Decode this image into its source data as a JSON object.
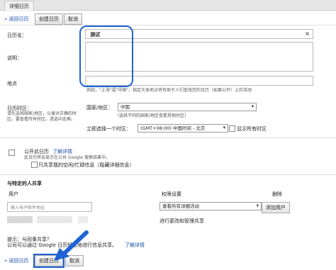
{
  "tab": "详细日历",
  "top_actions": {
    "back": "« 返回日历",
    "create": "创建日历",
    "cancel": "取消"
  },
  "form": {
    "name_label": "日历名：",
    "name_value": "测试",
    "desc_label": "说明：",
    "location_label": "地点",
    "location_hint": "例如，\"上海\"或\"中国\"，指定大体地点将有助于人们查找您的日历（如果公开）上的活动",
    "tz_label": "日历时区：",
    "tz_help": "请先选择国家/地区，以便对正确的时区。要查看所有时区，请选中此框。",
    "country_label": "国家/地区：",
    "country_value": "中国",
    "country_hint": "（选择不同的国家/地区查看其他时区）",
    "tz_now_label": "立即选择一个时区：",
    "tz_value": "(GMT+08:00) 中国时间 - 北京",
    "show_all_tz": "显示所有时区"
  },
  "public": {
    "label": "公开此日历",
    "learn_more": "了解详情",
    "note": "此日历将会显示在公共 Google 搜索结果中。",
    "free_busy": "只共享我的空闲/忙碌信息（隐藏详细信息）"
  },
  "share": {
    "title": "与特定的人共享",
    "col_user": "用户",
    "col_perm": "权限设置",
    "col_delete": "删除",
    "email_placeholder": "输入电子邮件地址",
    "perm_value": "查看所有详细活动",
    "add_button": "添加用户",
    "manage": "进行更改和管理共享"
  },
  "tip": {
    "line1": "提示：与同事共享？",
    "line2": "公司可以通过 Google 日历轻松地进行信息共享。",
    "learn_more": "了解详情"
  },
  "bottom_actions": {
    "back": "« 返回日历",
    "create": "创建日历",
    "cancel": "取消"
  },
  "colors": {
    "highlight": "#1e63d6",
    "link": "#1a4fb0"
  }
}
